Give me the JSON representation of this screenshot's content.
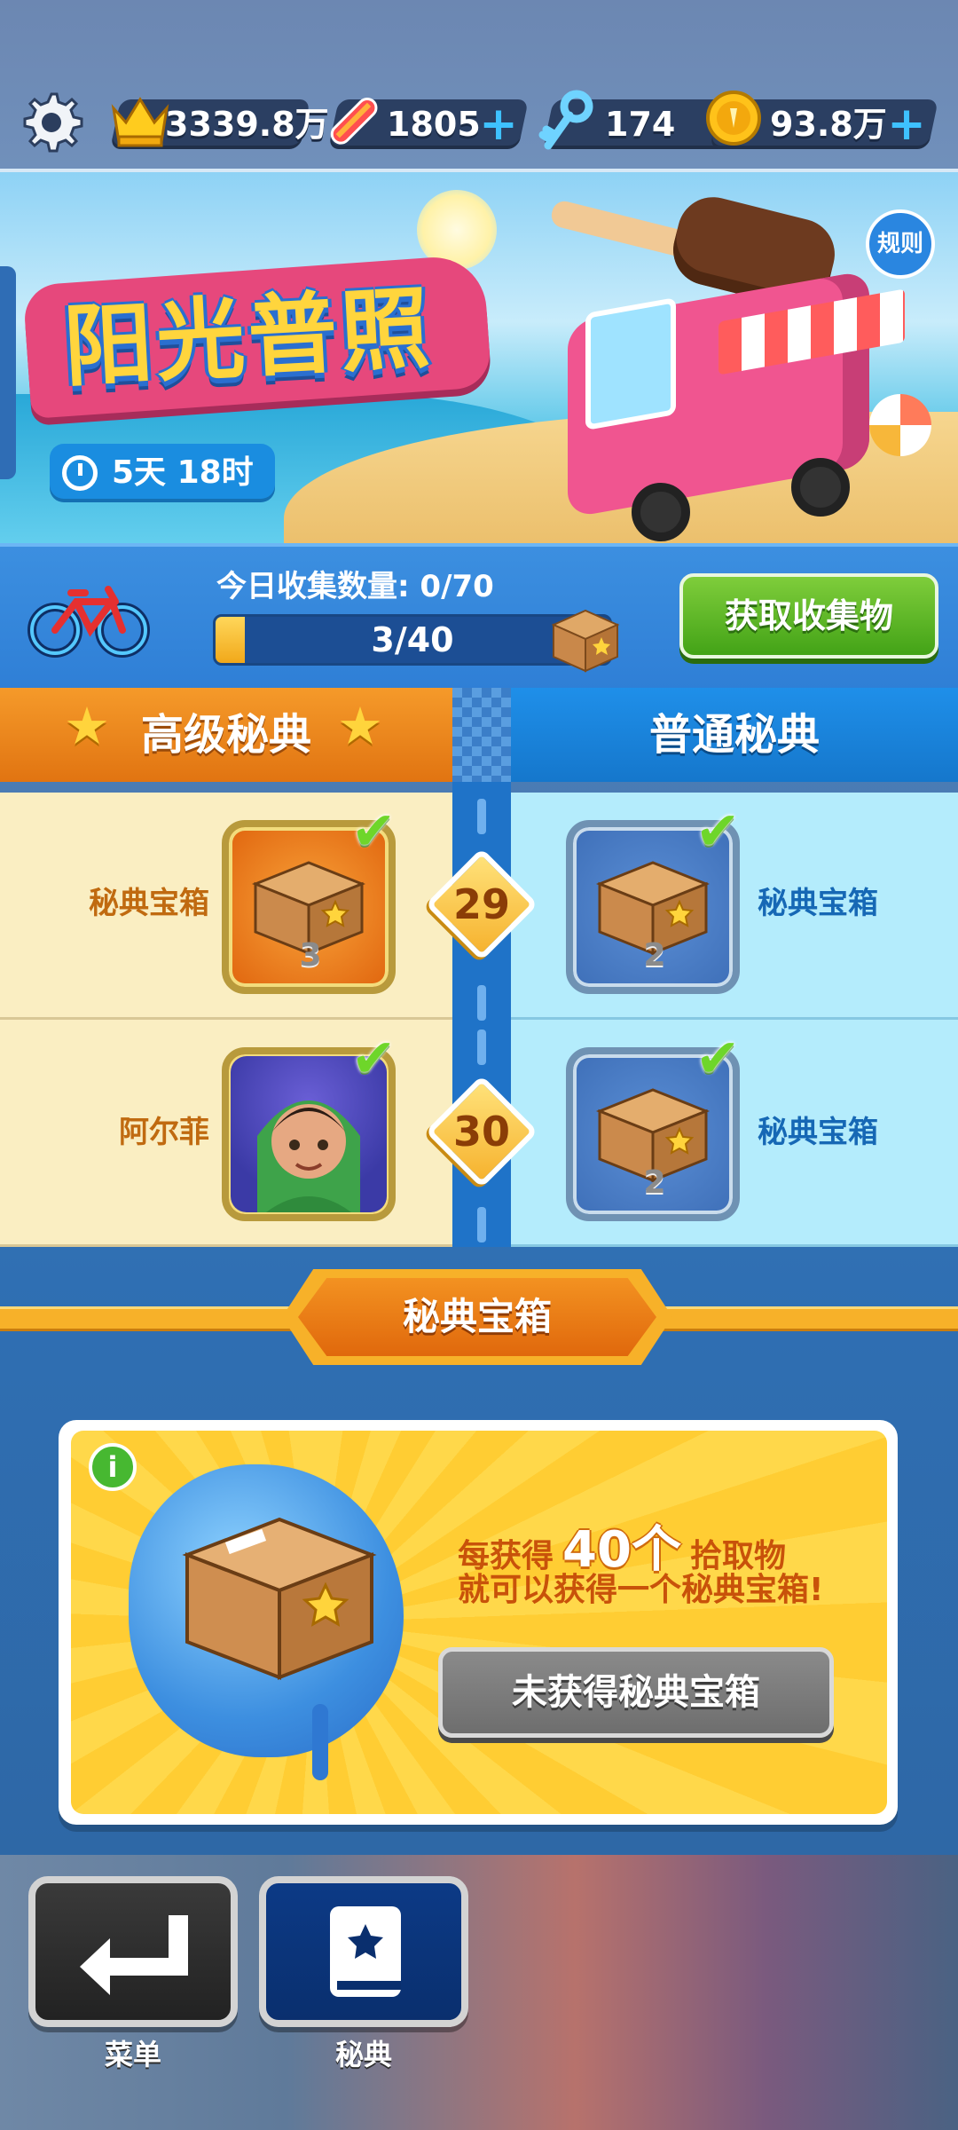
{
  "topbar": {
    "crown_value": "3339.8万",
    "skate_value": "1805",
    "key_value": "174",
    "coin_value": "93.8万"
  },
  "banner": {
    "title": "阳光普照",
    "timer": "5天 18时",
    "rules_label": "规则"
  },
  "collect": {
    "today_label": "今日收集数量: 0/70",
    "bar_text": "3/40",
    "bar_progress": 0.075,
    "get_button": "获取收集物"
  },
  "tabs": {
    "premium": "高级秘典",
    "normal": "普通秘典"
  },
  "rows": [
    {
      "level": "29",
      "premium_label": "秘典宝箱",
      "premium_count": "3",
      "normal_label": "秘典宝箱",
      "normal_count": "2"
    },
    {
      "level": "30",
      "premium_label": "阿尔菲",
      "normal_label": "秘典宝箱",
      "normal_count": "2"
    }
  ],
  "section": {
    "ribbon_title": "秘典宝箱",
    "info_prefix": "每获得",
    "info_big": "40个",
    "info_suffix": "拾取物",
    "info_line2": "就可以获得一个秘典宝箱!",
    "button": "未获得秘典宝箱"
  },
  "nav": {
    "menu_label": "菜单",
    "book_label": "秘典"
  },
  "colors": {
    "premium_tab": "#e17411",
    "normal_tab": "#1577cc",
    "get_button": "#43a317",
    "check": "#6ed62a"
  }
}
